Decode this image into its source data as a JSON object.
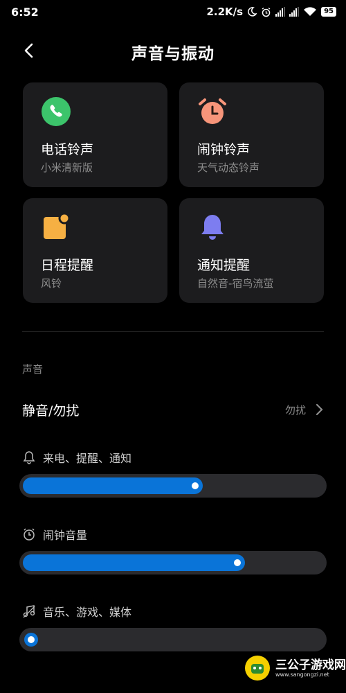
{
  "status_bar": {
    "time": "6:52",
    "network_speed": "2.2K/s",
    "battery": "95",
    "icons": [
      "moon-icon",
      "alarm-icon",
      "signal-icon",
      "signal-icon-2",
      "wifi-icon",
      "battery-icon"
    ]
  },
  "header": {
    "title": "声音与振动",
    "back_icon": "back-arrow-icon"
  },
  "cards": [
    {
      "title": "电话铃声",
      "subtitle": "小米清新版",
      "icon": "phone-icon",
      "color": "#3cc46b"
    },
    {
      "title": "闹钟铃声",
      "subtitle": "天气动态铃声",
      "icon": "alarm-clock-icon",
      "color": "#f7957a"
    },
    {
      "title": "日程提醒",
      "subtitle": "风铃",
      "icon": "calendar-icon",
      "color": "#f6b043"
    },
    {
      "title": "通知提醒",
      "subtitle": "自然音-宿鸟流萤",
      "icon": "bell-icon",
      "color": "#7d7df0"
    }
  ],
  "section": {
    "label": "声音"
  },
  "silent_row": {
    "label": "静音/勿扰",
    "value": "勿扰"
  },
  "volumes": [
    {
      "label": "来电、提醒、通知",
      "icon": "bell-outline-icon",
      "level": 0.6
    },
    {
      "label": "闹钟音量",
      "icon": "alarm-outline-icon",
      "level": 0.74
    },
    {
      "label": "音乐、游戏、媒体",
      "icon": "music-note-icon",
      "level": 0.0
    }
  ],
  "watermark": {
    "text": "三公子游戏网",
    "sub": "www.sangongzi.net"
  },
  "accent": "#0a74d8"
}
